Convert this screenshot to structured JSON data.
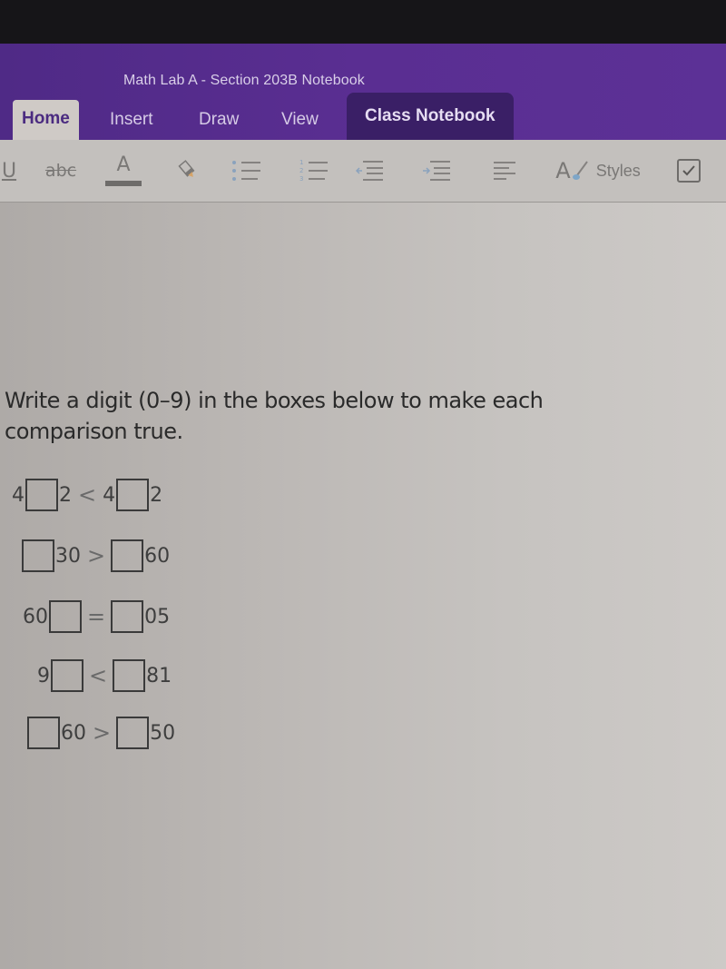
{
  "window": {
    "notebook_title": "Math Lab A - Section 203B Notebook"
  },
  "tabs": [
    {
      "label": "Home",
      "active": true
    },
    {
      "label": "Insert",
      "active": false
    },
    {
      "label": "Draw",
      "active": false
    },
    {
      "label": "View",
      "active": false
    },
    {
      "label": "Class Notebook",
      "active": false,
      "highlighted": true
    }
  ],
  "toolbar": {
    "items": [
      {
        "icon": "underline-icon",
        "glyph": "U"
      },
      {
        "icon": "strikethrough-icon",
        "glyph": "abc"
      },
      {
        "icon": "font-color-icon",
        "glyph": "A"
      },
      {
        "icon": "highlighter-icon"
      },
      {
        "icon": "bulleted-list-icon"
      },
      {
        "icon": "numbered-list-icon"
      },
      {
        "icon": "decrease-indent-icon"
      },
      {
        "icon": "increase-indent-icon"
      },
      {
        "icon": "align-left-icon"
      },
      {
        "icon": "styles-icon",
        "glyph": "A"
      },
      {
        "icon": "todo-checkbox-icon"
      }
    ],
    "styles_label": "Styles"
  },
  "colors": {
    "ribbon": "#5a2e92",
    "active_tab_bg": "#cfcac6",
    "active_tab_text": "#4b2b80",
    "highlight_tab_bg": "#3a1f66",
    "page_bg": "#c3c0bd"
  },
  "content": {
    "prompt": "Write a digit (0–9) in the boxes below to make each comparison true.",
    "comparisons": [
      {
        "left_prefix": "4",
        "left_suffix": "2",
        "operator": "<",
        "right_prefix": "4",
        "right_suffix": "2"
      },
      {
        "left_prefix": "",
        "left_suffix": "30",
        "operator": ">",
        "right_prefix": "",
        "right_suffix": "60"
      },
      {
        "left_prefix": "60",
        "left_suffix": "",
        "operator": "=",
        "right_prefix": "",
        "right_suffix": "05"
      },
      {
        "left_prefix": "9",
        "left_suffix": "",
        "operator": "<",
        "right_prefix": "",
        "right_suffix": "81"
      },
      {
        "left_prefix": "",
        "left_suffix": "60",
        "operator": ">",
        "right_prefix": "",
        "right_suffix": "50"
      }
    ]
  }
}
